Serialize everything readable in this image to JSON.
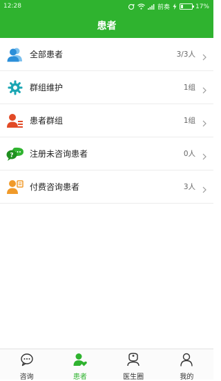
{
  "status_bar": {
    "time": "12:28",
    "carrier": "前奏",
    "battery": "17%",
    "battery_level": 0.17,
    "icons": [
      "sync-icon",
      "wifi-icon",
      "signal-icon",
      "charging-icon",
      "battery-icon"
    ]
  },
  "header": {
    "title": "患者"
  },
  "colors": {
    "brand_green": "#2fb32f",
    "blue": "#2b8fd9",
    "teal": "#1aa6b3",
    "orange_red": "#e24a26",
    "orange": "#f09a2a"
  },
  "list": [
    {
      "label": "全部患者",
      "value": "3/3人",
      "icon": "patients-icon"
    },
    {
      "label": "群组维护",
      "value": "1组",
      "icon": "gear-icon"
    },
    {
      "label": "患者群组",
      "value": "1组",
      "icon": "patient-group-icon"
    },
    {
      "label": "注册未咨询患者",
      "value": "0人",
      "icon": "chat-bubbles-icon"
    },
    {
      "label": "付费咨询患者",
      "value": "3人",
      "icon": "paid-patient-icon"
    }
  ],
  "tabs": [
    {
      "label": "咨询",
      "icon": "chat-icon",
      "active": false
    },
    {
      "label": "患者",
      "icon": "patient-heart-icon",
      "active": true
    },
    {
      "label": "医生圈",
      "icon": "doctor-icon",
      "active": false
    },
    {
      "label": "我的",
      "icon": "profile-icon",
      "active": false
    }
  ]
}
